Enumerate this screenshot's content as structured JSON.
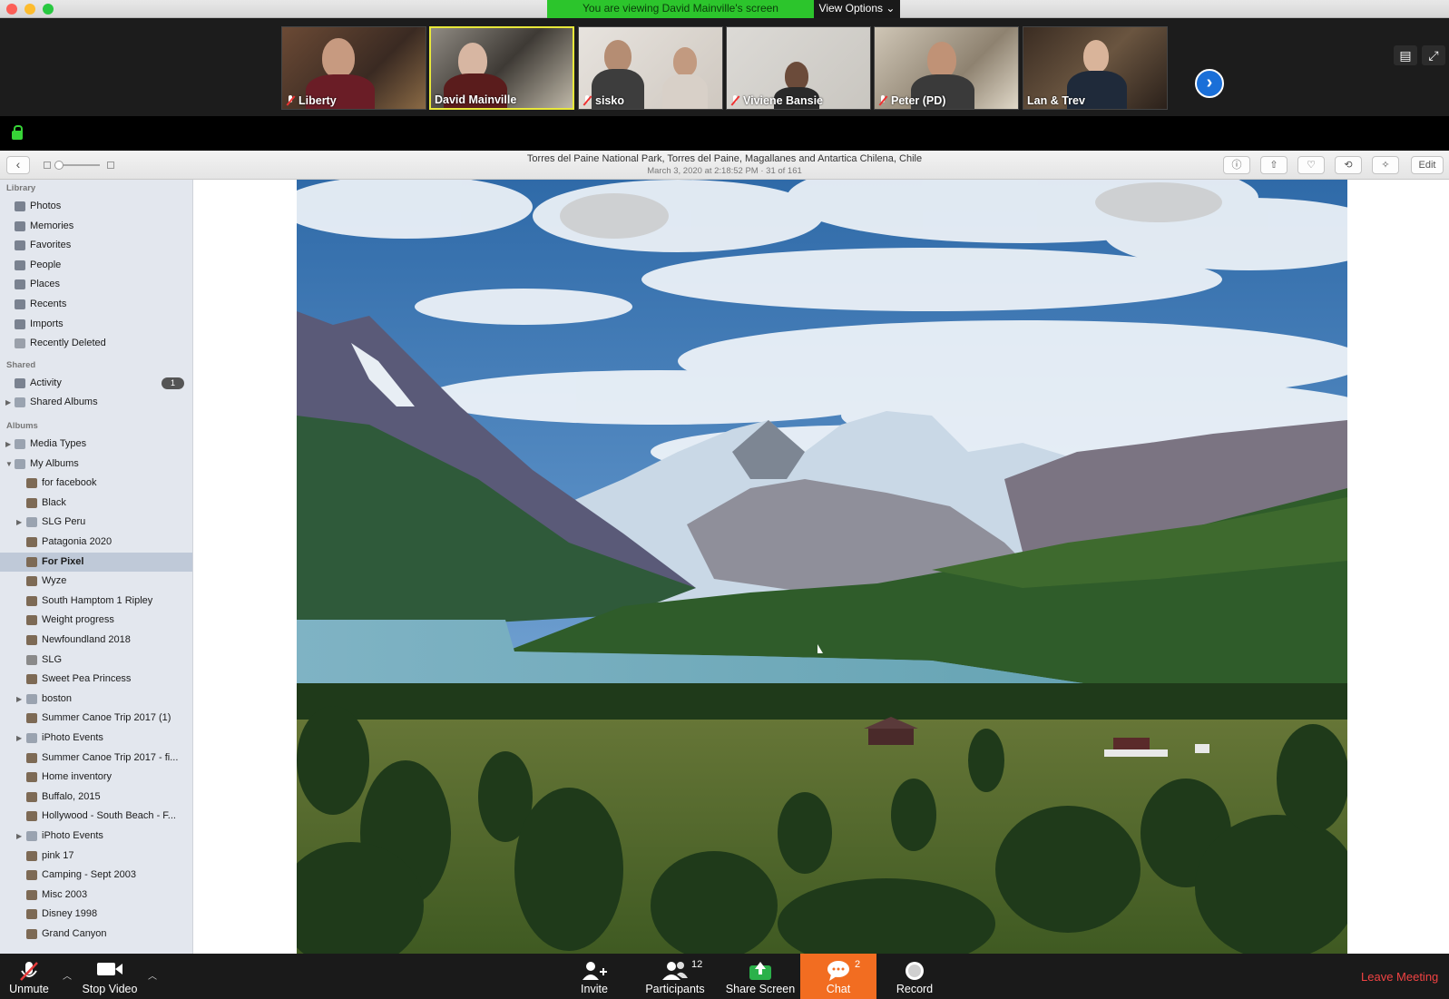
{
  "meeting": {
    "banner": "You are viewing David Mainville's screen",
    "view_options": "View Options"
  },
  "participants_gallery": [
    {
      "name": "Liberty"
    },
    {
      "name": "David Mainville"
    },
    {
      "name": "sisko"
    },
    {
      "name": "Viviene Bansie"
    },
    {
      "name": "Peter (PD)"
    },
    {
      "name": "Lan & Trev"
    }
  ],
  "photo_viewer": {
    "title": "Torres del Paine National Park, Torres del Paine, Magallanes and Antartica Chilena, Chile",
    "subtitle": "March 3, 2020 at 2:18:52 PM  ·  31 of 161",
    "edit_label": "Edit"
  },
  "sidebar": {
    "library_header": "Library",
    "library": [
      {
        "label": "Photos",
        "icon": "photos-icon"
      },
      {
        "label": "Memories",
        "icon": "memories-icon"
      },
      {
        "label": "Favorites",
        "icon": "heart-icon"
      },
      {
        "label": "People",
        "icon": "person-icon"
      },
      {
        "label": "Places",
        "icon": "pin-icon"
      },
      {
        "label": "Recents",
        "icon": "recents-icon"
      },
      {
        "label": "Imports",
        "icon": "camera-icon"
      },
      {
        "label": "Recently Deleted",
        "icon": "trash-icon"
      }
    ],
    "shared_header": "Shared",
    "shared": [
      {
        "label": "Activity",
        "icon": "cloud-icon",
        "badge": "1"
      },
      {
        "label": "Shared Albums",
        "icon": "folder-icon"
      }
    ],
    "albums_header": "Albums",
    "albums": [
      {
        "label": "Media Types",
        "icon": "folder-icon"
      },
      {
        "label": "My Albums",
        "icon": "folder-icon"
      },
      {
        "label": "for facebook",
        "icon": "album-icon"
      },
      {
        "label": "Black",
        "icon": "album-icon"
      },
      {
        "label": "SLG Peru",
        "icon": "folder-icon"
      },
      {
        "label": "Patagonia 2020",
        "icon": "album-icon"
      },
      {
        "label": "For Pixel",
        "icon": "album-icon"
      },
      {
        "label": "Wyze",
        "icon": "album-icon"
      },
      {
        "label": "South Hamptom 1 Ripley",
        "icon": "album-icon"
      },
      {
        "label": "Weight progress",
        "icon": "album-icon"
      },
      {
        "label": "Newfoundland 2018",
        "icon": "album-icon"
      },
      {
        "label": "SLG",
        "icon": "gear-icon"
      },
      {
        "label": "Sweet Pea Princess",
        "icon": "album-icon"
      },
      {
        "label": "boston",
        "icon": "folder-icon"
      },
      {
        "label": "Summer Canoe Trip 2017 (1)",
        "icon": "album-icon"
      },
      {
        "label": "iPhoto Events",
        "icon": "folder-icon"
      },
      {
        "label": "Summer Canoe Trip 2017 - fi...",
        "icon": "album-icon"
      },
      {
        "label": "Home inventory",
        "icon": "album-icon"
      },
      {
        "label": "Buffalo, 2015",
        "icon": "album-icon"
      },
      {
        "label": "Hollywood - South Beach - F...",
        "icon": "album-icon"
      },
      {
        "label": "iPhoto Events",
        "icon": "folder-icon"
      },
      {
        "label": "pink 17",
        "icon": "album-icon"
      },
      {
        "label": "Camping - Sept 2003",
        "icon": "album-icon"
      },
      {
        "label": "Misc 2003",
        "icon": "album-icon"
      },
      {
        "label": "Disney 1998",
        "icon": "album-icon"
      },
      {
        "label": "Grand Canyon",
        "icon": "album-icon"
      }
    ]
  },
  "controls": {
    "unmute": "Unmute",
    "stop_video": "Stop Video",
    "invite": "Invite",
    "participants": "Participants",
    "participants_count": "12",
    "share_screen": "Share Screen",
    "chat": "Chat",
    "chat_count": "2",
    "record": "Record",
    "leave": "Leave Meeting"
  },
  "colors": {
    "banner_green": "#2cc52c",
    "chat_orange": "#f26d21",
    "leave_red": "#f04343",
    "active_speaker": "#e8e83a"
  }
}
